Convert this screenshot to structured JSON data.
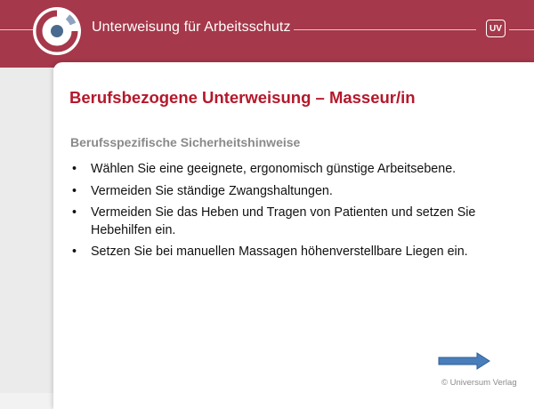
{
  "header": {
    "title": "Unterweisung für Arbeitsschutz",
    "badge": "UV"
  },
  "colors": {
    "header_bg": "#a5384a",
    "title_red": "#b5182b",
    "arrow_blue": "#4a7ebb"
  },
  "icons": {
    "logo": "circle-logo-icon",
    "next": "arrow-right-icon"
  },
  "main": {
    "title": "Berufsbezogene Unterweisung – Masseur/in",
    "section_heading": "Berufsspezifische Sicherheitshinweise",
    "bullets": [
      "Wählen Sie eine geeignete, ergonomisch günstige Arbeitsebene.",
      "Vermeiden Sie ständige Zwangshaltungen.",
      "Vermeiden Sie das Heben und Tragen von Patienten und setzen Sie Hebehilfen ein.",
      "Setzen Sie bei manuellen Massagen höhenverstellbare Liegen ein."
    ]
  },
  "footer": {
    "copyright": "© Universum Verlag"
  }
}
